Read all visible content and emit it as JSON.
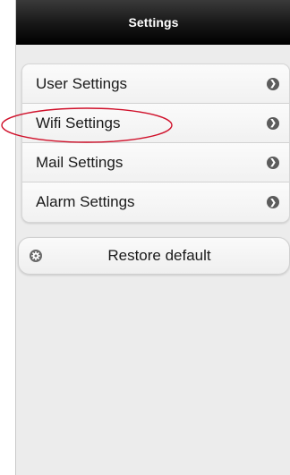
{
  "header": {
    "title": "Settings"
  },
  "menu": {
    "items": [
      {
        "label": "User Settings"
      },
      {
        "label": "Wifi Settings"
      },
      {
        "label": "Mail Settings"
      },
      {
        "label": "Alarm Settings"
      }
    ]
  },
  "restore": {
    "label": "Restore default"
  },
  "colors": {
    "titlebar": "#000000",
    "background": "#ececec",
    "highlight_annotation": "#d0112b"
  }
}
